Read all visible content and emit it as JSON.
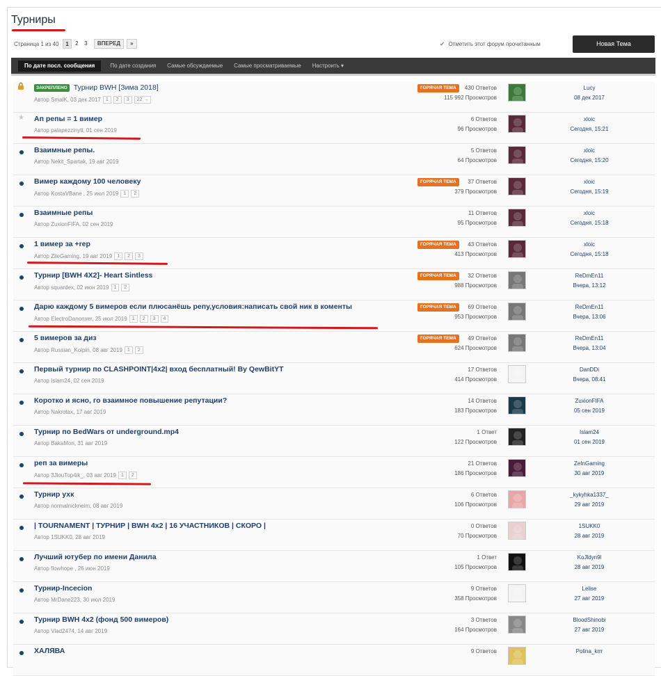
{
  "forum": {
    "title": "Турниры",
    "page_label": "Страница 1 из 40",
    "pages": [
      "1",
      "2",
      "3"
    ],
    "next_label": "ВПЕРЕД",
    "last_label": "»",
    "mark_read": "Отметить этот форум прочитанным",
    "new_topic": "Новая Тема"
  },
  "tabs": [
    {
      "label": "По дате посл. сообщения",
      "active": true
    },
    {
      "label": "По дате создания"
    },
    {
      "label": "Самые обсуждаемые"
    },
    {
      "label": "Самые просматриваемые"
    },
    {
      "label": "Настроить ▾"
    }
  ],
  "badges": {
    "pinned": "ЗАКРЕПЛЕНО",
    "hot": "ГОРЯЧАЯ ТЕМА"
  },
  "colors": {
    "accent": "#1f3f6a",
    "hot": "#e47220",
    "pinned": "#3e8e41",
    "underline": "#d21a1a"
  },
  "topics": [
    {
      "icon": "lock-icon",
      "pinned": true,
      "hot": true,
      "title": "Турнир BWH [Зима 2018]",
      "author": "Автор SmalK, 03 дек 2017",
      "pages": [
        "1",
        "2",
        "3",
        "22 →"
      ],
      "replies": "430 Ответов",
      "views": "115 992 Просмотров",
      "avatar": "#3d7a3a",
      "last_user": "Lucy",
      "last_date": "08 дек 2017"
    },
    {
      "icon": "star-icon",
      "title": "Ап репы = 1 вимер",
      "author": "Автор palapezzinytl, 01 сен 2019",
      "pages": [],
      "replies": "6 Ответов",
      "views": "96 Просмотров",
      "avatar": "#5a2a3a",
      "last_user": "xloic",
      "last_date": "Сегодня, 15:21"
    },
    {
      "icon": "dot-icon",
      "title": "Взаимные репы.",
      "author": "Автор Nekit_Spartak, 19 авг 2019",
      "pages": [],
      "replies": "5 Ответов",
      "views": "64 Просмотров",
      "avatar": "#5a2a3a",
      "last_user": "xloic",
      "last_date": "Сегодня, 15:20"
    },
    {
      "icon": "dot-icon",
      "hot": true,
      "title": "Вимер каждому 100 человеку",
      "author": "Автор KostaVBane , 25 июл 2019",
      "pages": [
        "1",
        "2"
      ],
      "replies": "37 Ответов",
      "views": "379 Просмотров",
      "avatar": "#5a2a3a",
      "last_user": "xloic",
      "last_date": "Сегодня, 15:19"
    },
    {
      "icon": "dot-icon",
      "title": "Взаимные репы",
      "author": "Автор ZuxionFIFA, 02 сен 2019",
      "pages": [],
      "replies": "11 Ответов",
      "views": "95 Просмотров",
      "avatar": "#5a2a3a",
      "last_user": "xloic",
      "last_date": "Сегодня, 15:18"
    },
    {
      "icon": "dot-icon",
      "hot": true,
      "title": "1 вимер за +rep",
      "author": "Автор ZileGaming, 19 авг 2019",
      "pages": [
        "1",
        "2",
        "3"
      ],
      "replies": "43 Ответов",
      "views": "413 Просмотров",
      "avatar": "#5a2a3a",
      "last_user": "xloic",
      "last_date": "Сегодня, 15:18"
    },
    {
      "icon": "dot-icon",
      "hot": true,
      "title": "Турнир [BWH 4X2]- Heart Sintless",
      "author": "Автор squardex, 02 июн 2019",
      "pages": [
        "1",
        "2"
      ],
      "replies": "32 Ответов",
      "views": "988 Просмотров",
      "avatar": "#777",
      "last_user": "ReDmEn11",
      "last_date": "Вчера, 13:12"
    },
    {
      "icon": "dot-icon",
      "hot": true,
      "title": "Дарю каждому 5 вимеров если плюсанёшь репу,условия:написать свой ник в коменты",
      "author": "Автор ElectroDanonxer, 25 июл 2019",
      "pages": [
        "1",
        "2",
        "3",
        "4"
      ],
      "replies": "69 Ответов",
      "views": "953 Просмотров",
      "avatar": "#777",
      "last_user": "ReDmEn11",
      "last_date": "Вчера, 13:06"
    },
    {
      "icon": "dot-icon",
      "hot": true,
      "title": "5 вимеров за диз",
      "author": "Автор Russian_Kolpin, 08 авг 2019",
      "pages": [
        "1",
        "2"
      ],
      "replies": "49 Ответов",
      "views": "624 Просмотров",
      "avatar": "#777",
      "last_user": "ReDmEn11",
      "last_date": "Вчера, 13:04"
    },
    {
      "icon": "dot-icon",
      "title": "Первый турнир по CLASHPOINT|4x2| вход бесплатный! By QewBitYT",
      "author": "Автор Islam24, 02 сен 2019",
      "pages": [],
      "replies": "17 Ответов",
      "views": "414 Просмотров",
      "avatar": "#f4f4f4",
      "last_user": "DanDDi",
      "last_date": "Вчера, 08:41"
    },
    {
      "icon": "dot-icon",
      "title": "Коротко и ясно, го взаимное повышение репутации?",
      "author": "Автор Nakrotax, 17 авг 2019",
      "pages": [],
      "replies": "14 Ответов",
      "views": "183 Просмотров",
      "avatar": "#1a3a4a",
      "last_user": "ZuxionFIFA",
      "last_date": "05 сен 2019"
    },
    {
      "icon": "dot-icon",
      "title": "Турнир по BedWars от underground.mp4",
      "author": "Автор BakaMori, 31 авг 2019",
      "pages": [],
      "replies": "1 Ответ",
      "views": "122 Просмотров",
      "avatar": "#222",
      "last_user": "Islam24",
      "last_date": "01 сен 2019"
    },
    {
      "icon": "dot-icon",
      "title": "реп за вимеры",
      "author": "Автор 3JlouTop4ik_, 03 авг 2019",
      "pages": [
        "1",
        "2"
      ],
      "replies": "21 Ответов",
      "views": "186 Просмотров",
      "avatar": "#4a1a3a",
      "last_user": "ZeInGaming",
      "last_date": "30 авг 2019"
    },
    {
      "icon": "dot-icon",
      "title": "Турнир ухк",
      "author": "Автор normalnickneim, 08 авг 2019",
      "pages": [],
      "replies": "6 Ответов",
      "views": "106 Просмотров",
      "avatar": "#e8a6a8",
      "last_user": "_kykyhka1337_",
      "last_date": "29 авг 2019"
    },
    {
      "icon": "dot-icon",
      "title": "| TOURNAMENT | ТУРНИР | BWH 4x2 | 16 УЧАСТНИКОВ | СКОРО |",
      "author": "Автор 1SUKK0, 28 авг 2019",
      "pages": [],
      "replies": "0 Ответов",
      "views": "70 Просмотров",
      "avatar": "#e8d0d0",
      "last_user": "1SUKK0",
      "last_date": "28 авг 2019"
    },
    {
      "icon": "dot-icon",
      "title": "Лучший ютубер по имени Данила",
      "author": "Автор flowhope , 26 июн 2019",
      "pages": [],
      "replies": "1 Ответ",
      "views": "105 Просмотров",
      "avatar": "#111",
      "last_user": "KoJldyn9l",
      "last_date": "28 авг 2019"
    },
    {
      "icon": "dot-icon",
      "title": "Турнир-Incecion",
      "author": "Автор MrDane223, 30 июл 2019",
      "pages": [],
      "replies": "9 Ответов",
      "views": "358 Просмотров",
      "avatar": "#f4f4f4",
      "last_user": "Lelise",
      "last_date": "27 авг 2019"
    },
    {
      "icon": "dot-icon",
      "title": "Турнир BWH 4x2 (фонд 500 вимеров)",
      "author": "Автор Vlad2474, 14 авг 2019",
      "pages": [],
      "replies": "3 Ответов",
      "views": "164 Просмотров",
      "avatar": "#888",
      "last_user": "BloodShinobi",
      "last_date": "27 авг 2019"
    },
    {
      "icon": "dot-icon",
      "title": "ХАЛЯВА",
      "author": "",
      "pages": [],
      "replies": "9 Ответов",
      "views": "",
      "avatar": "#e0c060",
      "last_user": "Polina_krrr",
      "last_date": ""
    }
  ]
}
